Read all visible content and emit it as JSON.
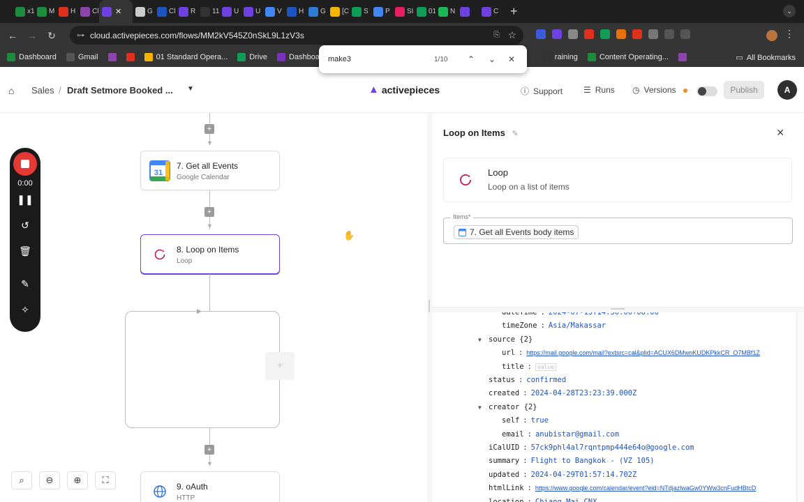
{
  "browser": {
    "tabs": [
      {
        "label": "x1",
        "color": "#1e8e3e"
      },
      {
        "label": "M",
        "color": "#1e8e3e"
      },
      {
        "label": "H",
        "color": "#e0301e"
      },
      {
        "label": "Cl",
        "color": "#8e44ad"
      },
      {
        "label": "",
        "color": "#6e41e2",
        "active": true
      },
      {
        "label": "G",
        "color": "#cccccc"
      },
      {
        "label": "Cl",
        "color": "#1d54c4"
      },
      {
        "label": "R",
        "color": "#6e41e2"
      },
      {
        "label": "11 D",
        "color": "#333333"
      },
      {
        "label": "U",
        "color": "#6e41e2"
      },
      {
        "label": "U",
        "color": "#6e41e2"
      },
      {
        "label": "V",
        "color": "#4285f4"
      },
      {
        "label": "H",
        "color": "#1d54c4"
      },
      {
        "label": "G",
        "color": "#2f7bd3"
      },
      {
        "label": "[C",
        "color": "#f4b400"
      },
      {
        "label": "S",
        "color": "#0f9d58"
      },
      {
        "label": "P",
        "color": "#4285f4"
      },
      {
        "label": "SI",
        "color": "#e91e63"
      },
      {
        "label": "01",
        "color": "#0f9d58"
      },
      {
        "label": "N",
        "color": "#1db954"
      },
      {
        "label": "",
        "color": "#6e41e2"
      },
      {
        "label": "C",
        "color": "#6e41e2"
      }
    ],
    "active_tab_close": "✕",
    "new_tab": "+",
    "url": "cloud.activepieces.com/flows/MM2kV545Z0nSkL9L1zV3s",
    "bookmarks": [
      {
        "label": "Dashboard",
        "color": "#1e8e3e"
      },
      {
        "label": "Gmail",
        "color": "#555555"
      },
      {
        "label": "",
        "color": "#8e44ad"
      },
      {
        "label": "",
        "color": "#e0301e"
      },
      {
        "label": "01 Standard Opera...",
        "color": "#f4b400"
      },
      {
        "label": "Drive",
        "color": "#0f9d58"
      },
      {
        "label": "Dashboard",
        "color": "#7b2fbf"
      }
    ],
    "bookmarks_right": [
      {
        "label": "raining",
        "color": "#333333"
      },
      {
        "label": "Content Operating...",
        "color": "#1e8e3e"
      },
      {
        "label": "",
        "color": "#8e44ad"
      }
    ],
    "all_bookmarks": "All Bookmarks",
    "find": {
      "query": "make3",
      "count": "1/10"
    }
  },
  "header": {
    "breadcrumb_root": "Sales",
    "breadcrumb_sep": "/",
    "flow_name": "Draft Setmore Booked ...",
    "brand": "activepieces",
    "support": "Support",
    "runs": "Runs",
    "versions": "Versions",
    "publish": "Publish",
    "avatar": "A"
  },
  "canvas": {
    "steps": [
      {
        "title": "7. Get all Events",
        "subtitle": "Google Calendar",
        "icon": "google-calendar-icon",
        "icon_text": "31"
      },
      {
        "title": "8. Loop on Items",
        "subtitle": "Loop",
        "icon": "loop-icon"
      },
      {
        "title": "9. oAuth",
        "subtitle": "HTTP",
        "icon": "globe-icon"
      }
    ],
    "recorder": {
      "time": "0:00"
    },
    "plus": "+"
  },
  "panel": {
    "title": "Loop on Items",
    "piece_name": "Loop",
    "piece_desc": "Loop on a list of items",
    "items_label": "Items*",
    "items_chip": "7. Get all Events body items"
  },
  "json_view": {
    "rows": [
      {
        "indent": 2,
        "key": "dateTime",
        "value": "2024-07-13T14:30:00+08:00"
      },
      {
        "indent": 2,
        "key": "timeZone",
        "value": "Asia/Makassar"
      },
      {
        "indent": 1,
        "key": "source {2}",
        "caret": true
      },
      {
        "indent": 2,
        "key": "url",
        "value": "https://mail.google.com/mail?extsrc=cal&plid=ACUX6DMwnKUDKPkkCR_O7MBf1Z",
        "link": true
      },
      {
        "indent": 2,
        "key": "title",
        "value": "value",
        "placeholder": true
      },
      {
        "indent": 1,
        "key": "status",
        "value": "confirmed"
      },
      {
        "indent": 1,
        "key": "created",
        "value": "2024-04-28T23:23:39.000Z"
      },
      {
        "indent": 1,
        "key": "creator {2}",
        "caret": true
      },
      {
        "indent": 2,
        "key": "self",
        "value": "true"
      },
      {
        "indent": 2,
        "key": "email",
        "value": "anubistar@gmail.com"
      },
      {
        "indent": 1,
        "key": "iCalUID",
        "value": "57ck9phl4al7rqntpmp444e64o@google.com"
      },
      {
        "indent": 1,
        "key": "summary",
        "value": "Flight to Bangkok - (VZ 105)"
      },
      {
        "indent": 1,
        "key": "updated",
        "value": "2024-04-29T01:57:14.702Z"
      },
      {
        "indent": 1,
        "key": "htmlLink",
        "value": "https://www.google.com/calendar/event?eid=NTdjazlwaGw0YWw3cnFudHBtcD",
        "link": true
      },
      {
        "indent": 1,
        "key": "location",
        "value": "Chiang Mai CNX"
      }
    ]
  }
}
